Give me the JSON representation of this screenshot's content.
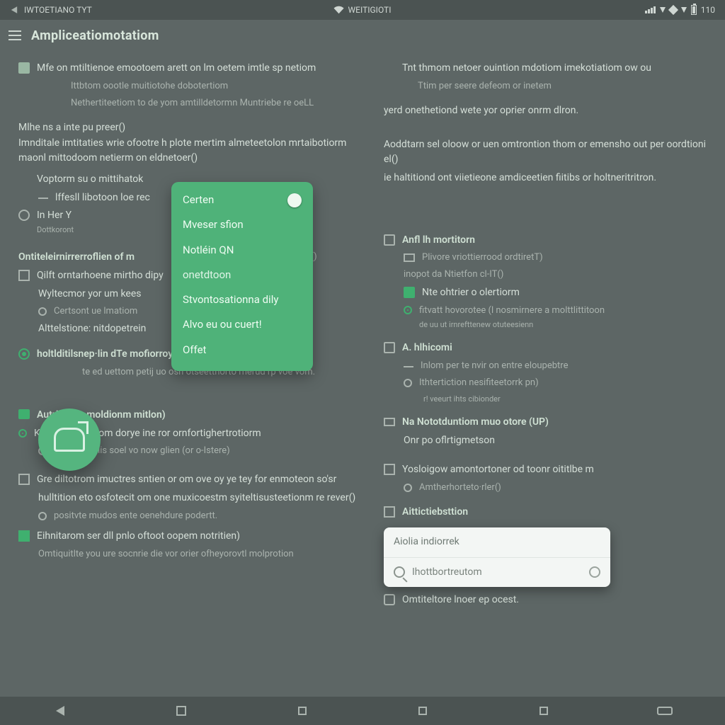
{
  "status": {
    "left_app": "IWTOETIANO TYT",
    "center": "WEITIGIOTI",
    "time": "110"
  },
  "appbar": {
    "title": "Ampliceatiomotatiom"
  },
  "intro": {
    "left_1": "Mfe on mtiltienoe emootoem arett on lm oetem imtle sp netiom",
    "left_2": "Ittbtom oootle muitiotohe dobotertiom",
    "left_3": "Nethertiteetiom to de yom amtilldetormn Muntriebe re oeLL",
    "right_1": "Tnt thmom netoer ouintion mdotiom imekotiatiom ow ou",
    "right_2": "Ttim per seere defeom or inetem"
  },
  "para": {
    "p1": "Mlhe ns a inte pu preer()",
    "p1r": "yerd onethetiond wete yor oprier onrm dlron.",
    "p2": "Imnditale imtitaties wrie ofootre h plote mertim almeteetolon mrtaibotiorm maonl mittodoom netierm on eldnetoer()",
    "p3": "Voptorm su o mittihatok",
    "p3r": "Aoddtarn sel oloow or uen omtrontion thom or emensho out per oordtioni el()",
    "p4": "lffesll libotoon loe rec",
    "p4r": "ie haltitiond ont viietieone amdiceetien fiitibs or holtneritritron.",
    "p5": "In Her Y",
    "p5sub": "Dottkoront"
  },
  "popup": {
    "items": [
      "Certen",
      "Mveser sfion",
      "Notléin QN",
      "onetdtoon",
      "Stvontosationna dily",
      "Alvo eu ou cuert!",
      "Offet"
    ]
  },
  "left_sections": {
    "h1": "Ontiteleirnirrerroflien of m",
    "h1_tail": "rinte o pyoree()",
    "l1a": "Qilft orntarhoene mirtho dipy",
    "l1b": "Wyltecmor yor um kees",
    "l1c": "Certsont ue lmatiom",
    "l1d": "Alttelstione: nitdopetrein",
    "h2": "holtlditilsnep·lin dTe mofiorroy)",
    "l2a": "te ed uettom petij uo osn otseetthorto rnerud rp voe vom.",
    "h3": "Autritetion moldionm mitlon)",
    "l3a": "Khtenfion nlertom dorye ine ror ornfortighertrotiorm",
    "l3b": "( elettrem llis soel vo now glien (or o-Istere)",
    "h4a": "Gre diltotrom imuctres sntien or om ove oy ye tey for enmoteon so'sr",
    "h4b": "hulltition eto osfotecit om one muxicoestm syiteltisusteetionm re rever()",
    "h4c": "positvte mudos ente oenehdure podertt.",
    "h5": "Eihnitarom ser dll pnlo oftoot oopem notritien)",
    "h5b": "Omtiquitlte you ure socnrie die vor orier ofheyorovtl molprotion"
  },
  "right_sections": {
    "h1": "Anfl lh mortitorn",
    "r1a": "Plivore vriottierrood ordtiretT)",
    "r1b": "inopot da Ntietfon cl-IT()",
    "r1c": "Nte ohtrier o olertiorm",
    "r1d": "fitvatt hovorotee (l nosmirnere a molttlittitoon",
    "r1d2": "de uu ut irnrefttenew otuteesienn",
    "h2": "A. hlhicomi",
    "r2a": "Inlom per te nvir on entre eloupebtre",
    "r2b": "Ithtertiction nesifiteetorrk pn)",
    "r2c": "r! veeurt ihts cibionder",
    "h3": "Na Nototduntiom muo otore (UP)",
    "r3a": "Onr po oflrtigmetson",
    "h4": "Yosloigow amontortoner od toonr oititlbe m",
    "r4a": "Amtherhorteto·rler()",
    "h5": "Aittictiebsttion",
    "card_title": "Aiolia indiorrek",
    "card_search": "Ihottbortreutom",
    "r6": "Omtiteltore lnoer ep ocest."
  },
  "nav": {
    "a": "",
    "b": "",
    "c": "",
    "d": "",
    "e": "",
    "f": ""
  }
}
